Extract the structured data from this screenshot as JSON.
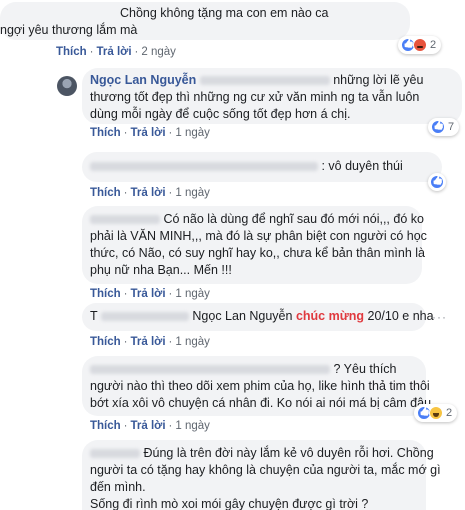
{
  "comments": [
    {
      "text_lines": [
        "Chồng không tặng ma con em nào ca",
        "ngợi yêu thương lắm mà"
      ],
      "actions": {
        "like": "Thích",
        "reply": "Trả lời",
        "time": "2 ngày"
      },
      "reactions": {
        "types": [
          "like-icon",
          "angry-icon"
        ],
        "count": "2"
      }
    },
    {
      "author": "Ngọc Lan Nguyễn",
      "text_lines": [
        "những lời lẽ yêu",
        "thương tốt đẹp thì những ng cư xử văn minh ng ta vẫn luôn",
        "dùng mỗi ngày để cuộc sống tốt đẹp hơn á chị."
      ],
      "actions": {
        "like": "Thích",
        "reply": "Trả lời",
        "time": "1 ngày"
      },
      "reactions": {
        "types": [
          "like-icon"
        ],
        "count": "7"
      }
    },
    {
      "text_lines": [
        ": vô duyên thúi"
      ],
      "actions": {
        "like": "Thích",
        "reply": "Trả lời",
        "time": "1 ngày"
      },
      "reactions": {
        "types": [
          "like-icon"
        ],
        "count": ""
      }
    },
    {
      "text_lines": [
        "Có não là dùng để nghĩ sau đó mới nói,,, đó ko",
        "phải là VĂN MINH,,, mà đó là sự phân biệt con người có học",
        "thức, có Não, có suy nghĩ hay ko,, chưa kể bản thân mình là",
        "phụ nữ nha Bạn... Mến !!!"
      ],
      "actions": {
        "like": "Thích",
        "reply": "Trả lời",
        "time": "1 ngày"
      }
    },
    {
      "prefix": "T",
      "author": "Ngọc Lan Nguyễn",
      "highlight": "chúc mừng",
      "text_rest": "20/10 e nha",
      "actions": {
        "like": "Thích",
        "reply": "Trả lời",
        "time": "1 ngày"
      }
    },
    {
      "text_lines": [
        "? Yêu thích",
        "người nào thì theo dõi xem phim của họ, like hình thả tim thôi",
        "bớt xía xôi vô chuyện cá nhân đi. Ko nói ai nói má bị câm đâu"
      ],
      "actions": {
        "like": "Thích",
        "reply": "Trả lời",
        "time": "1 ngày"
      },
      "reactions": {
        "types": [
          "like-icon",
          "haha-icon"
        ],
        "count": "2"
      }
    },
    {
      "text_lines": [
        "Đúng là trên đời này lắm kẻ vô duyên rỗi hơi. Chồng",
        "người ta có tặng hay không là chuyện của người ta, mắc mớ gì",
        "đến mình.",
        "Sống đi rình mò xoi mói gây chuyện được gì trời ?"
      ]
    }
  ],
  "more_icon": "ellipsis-icon"
}
